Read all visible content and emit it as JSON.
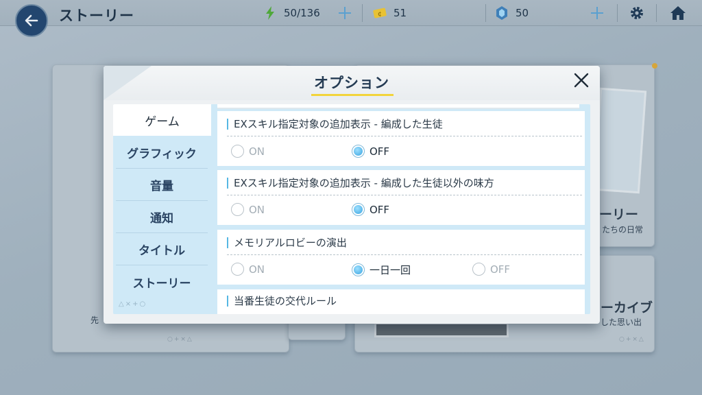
{
  "header": {
    "title": "ストーリー",
    "ap": "50/136",
    "credits": "51",
    "gems": "50"
  },
  "background": {
    "card_right_title": "ーリー",
    "card_right_sub": "たちの日常",
    "card_archive_title": "ーカイブ",
    "card_archive_sub": "した思い出",
    "card_left_sub": "先",
    "deco": "○+×△"
  },
  "modal": {
    "title": "オプション",
    "tabs": [
      {
        "label": "ゲーム",
        "active": true
      },
      {
        "label": "グラフィック",
        "active": false
      },
      {
        "label": "音量",
        "active": false
      },
      {
        "label": "通知",
        "active": false
      },
      {
        "label": "タイトル",
        "active": false
      },
      {
        "label": "ストーリー",
        "active": false
      }
    ],
    "tabs_deco": "△×+○",
    "settings": [
      {
        "label": "EXスキル指定対象の追加表示 - 編成した生徒",
        "options": [
          {
            "label": "ON",
            "selected": false
          },
          {
            "label": "OFF",
            "selected": true
          }
        ]
      },
      {
        "label": "EXスキル指定対象の追加表示 - 編成した生徒以外の味方",
        "options": [
          {
            "label": "ON",
            "selected": false
          },
          {
            "label": "OFF",
            "selected": true
          }
        ]
      },
      {
        "label": "メモリアルロビーの演出",
        "options": [
          {
            "label": "ON",
            "selected": false
          },
          {
            "label": "一日一回",
            "selected": true
          },
          {
            "label": "OFF",
            "selected": false
          }
        ]
      },
      {
        "label": "当番生徒の交代ルール",
        "options": []
      }
    ]
  },
  "colors": {
    "accent": "#56b7e3",
    "title_underline": "#f2d43a",
    "tab_bg": "#cfe9f7",
    "header_dark": "#23466f"
  }
}
